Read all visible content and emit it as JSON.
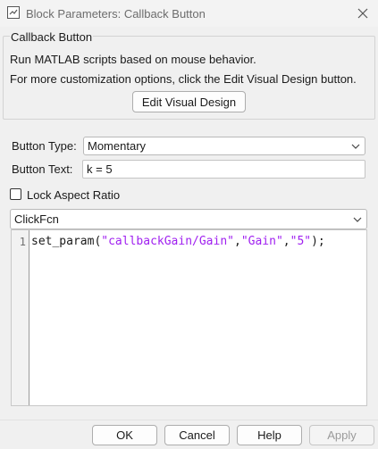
{
  "window": {
    "title": "Block Parameters: Callback Button",
    "close_icon": "close-icon"
  },
  "group": {
    "title": "Callback Button",
    "description_line1": "Run MATLAB scripts based on mouse behavior.",
    "description_line2": "For more customization options, click the Edit Visual Design button.",
    "edit_visual_design_label": "Edit Visual Design"
  },
  "params": {
    "button_type_label": "Button Type:",
    "button_type_value": "Momentary",
    "button_text_label": "Button Text:",
    "button_text_value": "k = 5",
    "lock_aspect_ratio_label": "Lock Aspect Ratio",
    "lock_aspect_ratio_checked": false,
    "callback_select_value": "ClickFcn"
  },
  "editor": {
    "line_number": "1",
    "code": {
      "func": "set_param(",
      "arg1": "\"callbackGain/Gain\"",
      "comma1": ",",
      "arg2": "\"Gain\"",
      "comma2": ",",
      "arg3": "\"5\"",
      "end": ");"
    }
  },
  "footer": {
    "ok_label": "OK",
    "cancel_label": "Cancel",
    "help_label": "Help",
    "apply_label": "Apply"
  },
  "colors": {
    "string_literal": "#a020f0",
    "background": "#f0f0f0"
  }
}
